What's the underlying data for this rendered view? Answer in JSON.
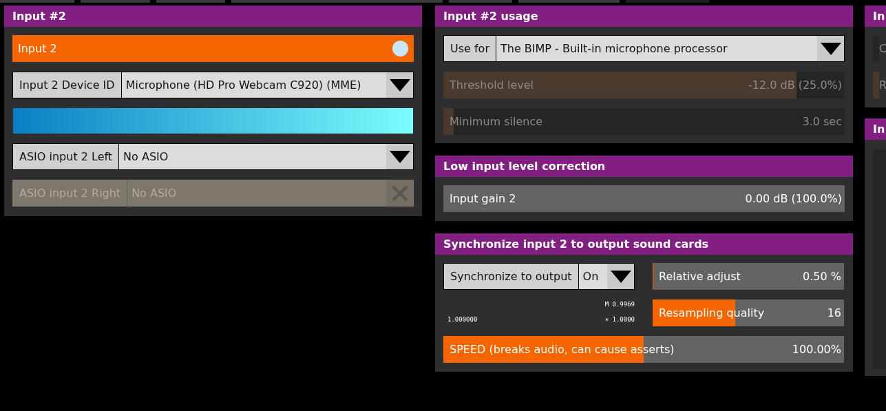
{
  "left_panel": {
    "title": "Input #2",
    "rows": [
      {
        "kind": "toggle",
        "label": "Input 2",
        "on": true
      },
      {
        "kind": "combo",
        "label": "Input 2 Device ID",
        "value": "Microphone (HD Pro Webcam C920) (MME)",
        "disabled": false
      },
      {
        "kind": "meter"
      },
      {
        "kind": "combo",
        "label": "ASIO input 2 Left",
        "value": "No ASIO",
        "disabled": false
      },
      {
        "kind": "combo",
        "label": "ASIO input 2 Right",
        "value": "No ASIO",
        "disabled": true
      }
    ]
  },
  "usage_panel": {
    "title": "Input #2 usage",
    "rows": [
      {
        "kind": "combo",
        "label": "Use for",
        "value": "The BIMP - Built-in microphone processor",
        "disabled": false
      },
      {
        "kind": "slider",
        "label": "Threshold level",
        "reading": "-12.0 dB (25.0%)",
        "level": 0.88,
        "disabled": true
      },
      {
        "kind": "slider",
        "label": "Minimum silence",
        "reading": "3.0 sec",
        "level": 0.025,
        "disabled": true
      }
    ]
  },
  "gain_panel": {
    "title": "Low input level correction",
    "rows": [
      {
        "kind": "slider",
        "label": "Input gain 2",
        "reading": "0.00 dB (100.0%)",
        "disabled": false
      }
    ]
  },
  "sync_panel": {
    "title": "Synchronize input 2 to output sound cards",
    "sync_combo": {
      "label": "Synchronize to output",
      "value": "On",
      "disabled": false
    },
    "stats": {
      "measured": "M 0.9969",
      "ratio": "1.000000",
      "multiplier": "× 1.0000"
    },
    "relative_adjust": {
      "label": "Relative adjust",
      "reading": "0.50 %",
      "level": 0.005,
      "disabled": false
    },
    "resampling": {
      "label": "Resampling quality",
      "reading": "16",
      "level": 0.43,
      "disabled": false
    },
    "speed": {
      "label": "SPEED (breaks audio, can cause asserts)",
      "reading": "100.00%",
      "level": 0.5,
      "disabled": false
    }
  },
  "right_panels": [
    {
      "title": "In",
      "rows": [
        {
          "kind": "slider",
          "label": "C",
          "disabled": true
        },
        {
          "kind": "slider",
          "label": "R",
          "level": 1,
          "disabled": true
        }
      ]
    },
    {
      "title": "In"
    }
  ]
}
